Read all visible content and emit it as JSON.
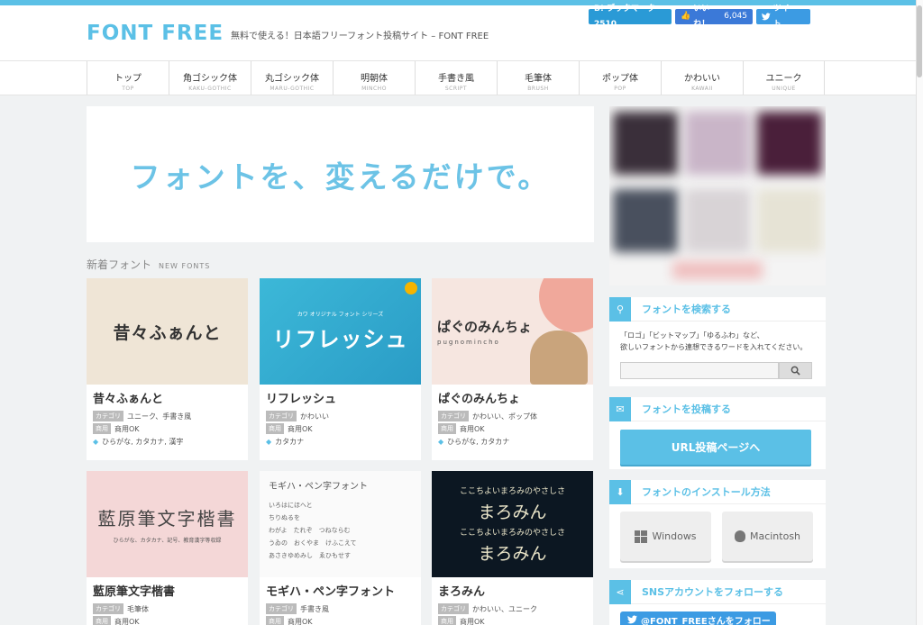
{
  "header": {
    "logo": "FONT FREE",
    "tagline": "無料で使える！日本語フリーフォント投稿サイト – FONT FREE",
    "social": {
      "hatena": "B! ブックマーク 2510",
      "like_label": "いいね！",
      "like_count": "6,045",
      "tweet": "ツイート"
    }
  },
  "nav": [
    {
      "jp": "トップ",
      "en": "TOP"
    },
    {
      "jp": "角ゴシック体",
      "en": "KAKU-GOTHIC"
    },
    {
      "jp": "丸ゴシック体",
      "en": "MARU-GOTHIC"
    },
    {
      "jp": "明朝体",
      "en": "MINCHO"
    },
    {
      "jp": "手書き風",
      "en": "SCRIPT"
    },
    {
      "jp": "毛筆体",
      "en": "BRUSH"
    },
    {
      "jp": "ポップ体",
      "en": "POP"
    },
    {
      "jp": "かわいい",
      "en": "KAWAII"
    },
    {
      "jp": "ユニーク",
      "en": "UNIQUE"
    }
  ],
  "hero": {
    "text": "フォントを、変えるだけで。"
  },
  "section": {
    "jp": "新着フォント",
    "en": "NEW FONTS"
  },
  "labels": {
    "category": "カテゴリ",
    "commercial": "商用"
  },
  "cards": [
    {
      "thumb": "昔々ふぁんと",
      "title": "昔々ふぁんと",
      "category": "ユニーク、手書き風",
      "commercial": "商用OK",
      "keywords": "ひらがな, カタカナ, 漢字"
    },
    {
      "thumb": "リフレッシュ",
      "thumb_sub": "カワ オリジナル フォント シリーズ",
      "title": "リフレッシュ",
      "category": "かわいい",
      "commercial": "商用OK",
      "keywords": "カタカナ"
    },
    {
      "thumb": "ぱぐのみんちょ",
      "thumb_sub": "pugnomincho",
      "title": "ぱぐのみんちょ",
      "category": "かわいい、ポップ体",
      "commercial": "商用OK",
      "keywords": "ひらがな, カタカナ"
    },
    {
      "thumb": "藍原筆文字楷書",
      "thumb_sub": "ひらがな、カタカナ、記号、教育漢字等収録",
      "title": "藍原筆文字楷書",
      "category": "毛筆体",
      "commercial": "商用OK"
    },
    {
      "thumb": "モギハ・ペン字フォント",
      "thumb_lines": [
        "いろはにほへと",
        "ちりぬるを",
        "わがよ　たれぞ　つねならむ",
        "うゐの　おくやま　けふこえて",
        "あさきゆめみし　ゑひもせす"
      ],
      "title": "モギハ・ペン字フォント",
      "category": "手書き風",
      "commercial": "商用OK"
    },
    {
      "thumb": "まろみん",
      "thumb_lines": [
        "ここちよいまろみのやさしさ",
        "まろみん",
        "ここちよいまろみのやさしさ",
        "まろみん"
      ],
      "title": "まろみん",
      "category": "かわいい、ユニーク",
      "commercial": "商用OK"
    }
  ],
  "sidebar": {
    "search": {
      "title": "フォントを検索する",
      "desc1": "「ロゴ」「ビットマップ」「ゆるふわ」など、",
      "desc2": "欲しいフォントから連想できるワードを入れてください。",
      "placeholder": ""
    },
    "submit": {
      "title": "フォントを投稿する",
      "button": "URL投稿ページへ"
    },
    "install": {
      "title": "フォントのインストール方法",
      "windows": "Windows",
      "mac": "Macintosh"
    },
    "sns": {
      "title": "SNSアカウントをフォローする",
      "button": "@FONT_FREEさんをフォロー"
    }
  },
  "colors": {
    "accent": "#5bc0e6",
    "text": "#333333",
    "background": "#f0f2f3"
  }
}
